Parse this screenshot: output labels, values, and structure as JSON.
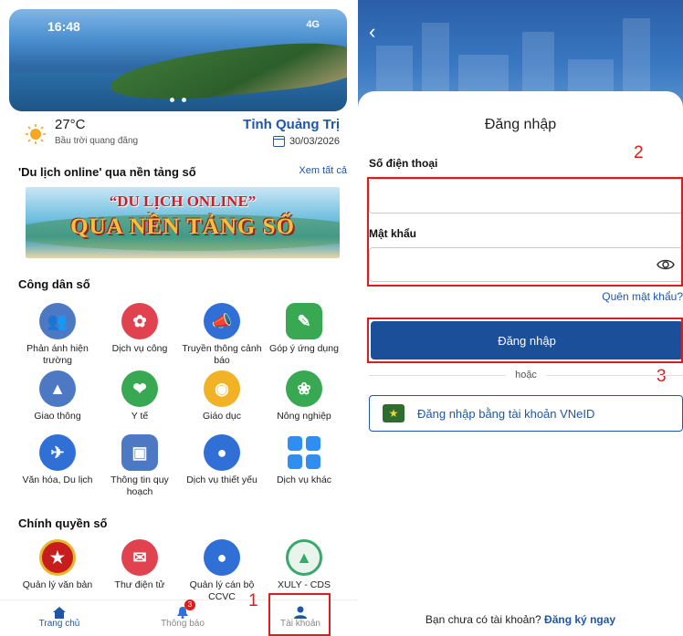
{
  "left": {
    "status": {
      "time": "16:48",
      "signal": "4G"
    },
    "weather": {
      "temperature": "27°C",
      "description": "Bầu trời quang đãng",
      "province": "Tỉnh Quảng Trị",
      "date": "30/03/2026"
    },
    "tourism": {
      "title": "'Du lịch online' qua nền tảng số",
      "see_all": "Xem tất cả",
      "banner_line1": "“DU LỊCH ONLINE”",
      "banner_line2": "QUA NỀN TẢNG SỐ"
    },
    "citizen": {
      "title": "Công dân số",
      "items": [
        {
          "label": "Phản ánh hiện trường",
          "icon": "megaphone-people-icon",
          "color": "#4d79c4"
        },
        {
          "label": "Dịch vụ công",
          "icon": "public-service-icon",
          "color": "#e0434f"
        },
        {
          "label": "Truyền thông cảnh báo",
          "icon": "megaphone-icon",
          "color": "#2f6fd6"
        },
        {
          "label": "Góp ý ứng dụng",
          "icon": "feedback-icon",
          "color": "#39a852"
        },
        {
          "label": "Giao thông",
          "icon": "traffic-icon",
          "color": "#4d79c4"
        },
        {
          "label": "Y tế",
          "icon": "medical-heart-icon",
          "color": "#39a852"
        },
        {
          "label": "Giáo dục",
          "icon": "graduation-cap-icon",
          "color": "#f2b225"
        },
        {
          "label": "Nông nghiệp",
          "icon": "agriculture-icon",
          "color": "#39a852"
        },
        {
          "label": "Văn hóa, Du lịch",
          "icon": "culture-travel-icon",
          "color": "#2f6fd6"
        },
        {
          "label": "Thông tin quy hoạch",
          "icon": "planning-map-icon",
          "color": "#4d79c4"
        },
        {
          "label": "Dịch vụ thiết yếu",
          "icon": "water-drop-icon",
          "color": "#2f6fd6"
        },
        {
          "label": "Dịch vụ khác",
          "icon": "grid-apps-icon",
          "color": "#2f8ef0"
        }
      ]
    },
    "gov": {
      "title": "Chính quyền số",
      "items": [
        {
          "label": "Quản lý văn bản",
          "icon": "national-emblem-icon",
          "color": "#c81d1d"
        },
        {
          "label": "Thư điện tử",
          "icon": "mail-icon",
          "color": "#e0434f"
        },
        {
          "label": "Quản lý cán bộ CCVC",
          "icon": "user-profile-icon",
          "color": "#2f6fd6"
        },
        {
          "label": "XULY - CDS",
          "icon": "xuly-cds-logo-icon",
          "color": "#3aa86a"
        }
      ]
    },
    "nav": {
      "home": "Trang chủ",
      "notifications": "Thông báo",
      "notification_badge": "3",
      "account": "Tài khoản"
    },
    "annotation": "1"
  },
  "right": {
    "title": "Đăng nhập",
    "phone_label": "Số điện thoại",
    "phone_value": "",
    "password_label": "Mật khẩu",
    "password_value": "",
    "forgot": "Quên mật khẩu?",
    "login_button": "Đăng nhập",
    "or": "hoặc",
    "vneid_button": "Đăng nhập bằng tài khoản VNeID",
    "register_prompt": "Bạn chưa có tài khoản?",
    "register_link": "Đăng ký ngay",
    "annotation_fields": "2",
    "annotation_button": "3"
  }
}
